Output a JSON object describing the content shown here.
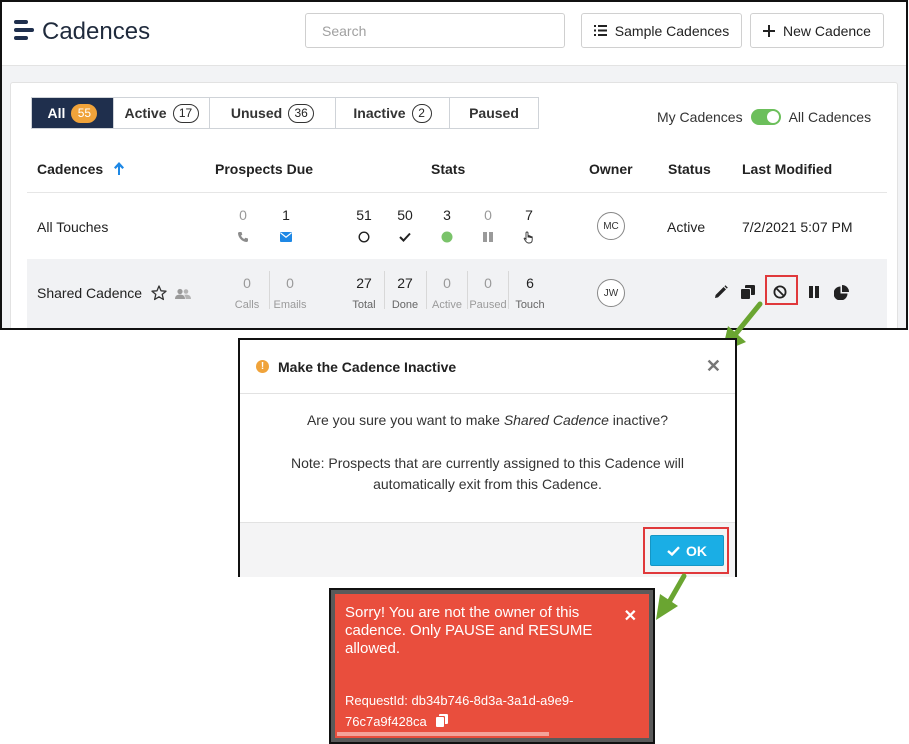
{
  "app": {
    "title": "Cadences",
    "search_placeholder": "Search",
    "sample_label": "Sample Cadences",
    "new_label": "New Cadence"
  },
  "tabs": [
    {
      "label": "All",
      "count": "55"
    },
    {
      "label": "Active",
      "count": "17"
    },
    {
      "label": "Unused",
      "count": "36"
    },
    {
      "label": "Inactive",
      "count": "2"
    },
    {
      "label": "Paused",
      "count": ""
    }
  ],
  "filter": {
    "left_label": "My Cadences",
    "right_label": "All Cadences"
  },
  "columns": {
    "cadences": "Cadences",
    "prospects_due": "Prospects Due",
    "stats": "Stats",
    "owner": "Owner",
    "status": "Status",
    "last_modified": "Last Modified"
  },
  "rows": [
    {
      "name": "All Touches",
      "calls": "0",
      "emails": "1",
      "total": "51",
      "done": "50",
      "active": "3",
      "paused": "0",
      "touch": "7",
      "owner": "MC",
      "status": "Active",
      "modified": "7/2/2021 5:07 PM"
    },
    {
      "name": "Shared Cadence",
      "calls": "0",
      "emails": "0",
      "total": "27",
      "done": "27",
      "active": "0",
      "paused": "0",
      "touch": "6",
      "owner": "JW"
    }
  ],
  "sublabels": {
    "calls": "Calls",
    "emails": "Emails",
    "total": "Total",
    "done": "Done",
    "active": "Active",
    "paused": "Paused",
    "touch": "Touch"
  },
  "modal": {
    "title": "Make the Cadence Inactive",
    "q_pre": "Are you sure you want to make ",
    "q_name": "Shared Cadence",
    "q_post": " inactive?",
    "note_line1": "Note: Prospects that are currently assigned to this Cadence will",
    "note_line2": "automatically exit from this Cadence.",
    "ok_label": "OK"
  },
  "toast": {
    "message": "Sorry! You are not the owner of this cadence. Only PAUSE and RESUME allowed.",
    "request_line1": "RequestId: db34b746-8d3a-3a1d-a9e9-",
    "request_line2": "76c7a9f428ca"
  },
  "colors": {
    "navy": "#1f2f4d",
    "badge_orange": "#f0a33a",
    "toggle_green": "#6cbf5b",
    "ok_blue": "#1aaee5",
    "toast_red": "#e94e3d",
    "highlight_red": "#e0393b",
    "arrow_green": "#6aa531"
  }
}
